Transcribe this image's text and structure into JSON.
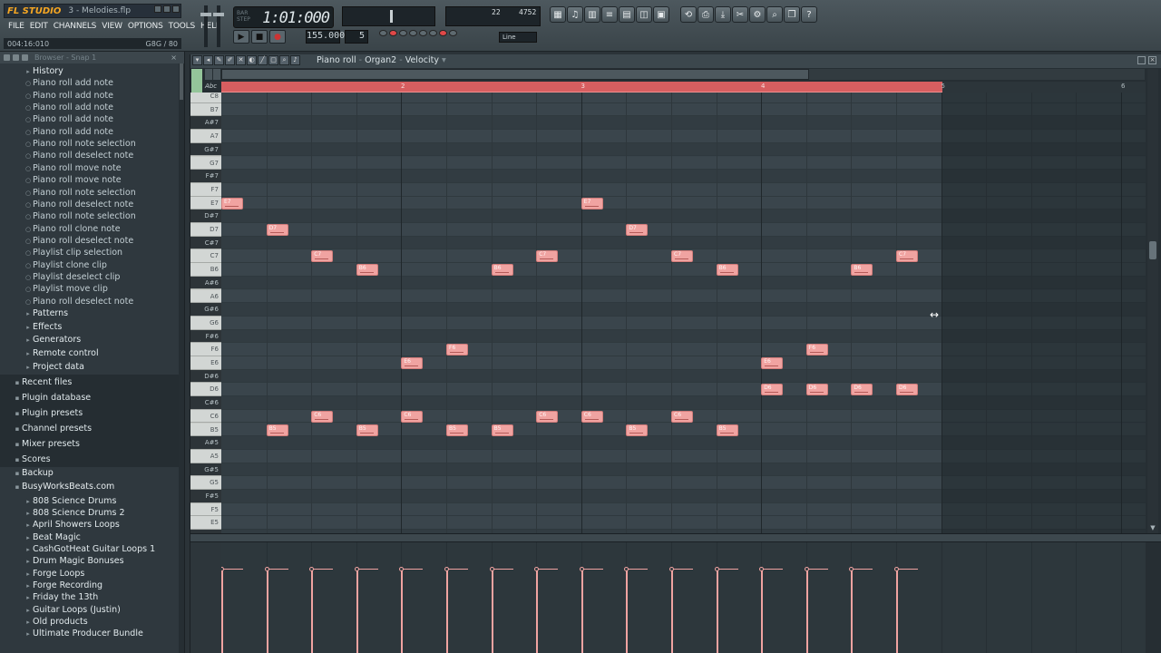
{
  "app": {
    "logo": "FL STUDIO",
    "project": "3 - Melodies.flp",
    "menu": [
      "FILE",
      "EDIT",
      "CHANNELS",
      "VIEW",
      "OPTIONS",
      "TOOLS",
      "HELP"
    ],
    "hint_left": "004:16:010",
    "hint_right": "G8G / 80"
  },
  "transport": {
    "time_pre": "BAR\nSTEP",
    "time": "1:01:000",
    "tempo": "155.000",
    "pattern": "5",
    "cpu_left": "22",
    "cpu_right": "4752",
    "snap": "Line"
  },
  "toolbar_icons": [
    "playlist-icon",
    "piano-roll-icon",
    "step-seq-icon",
    "mixer-icon",
    "channel-icon",
    "plugin-icon",
    "view-icon",
    "undo-icon",
    "save-icon",
    "export-icon",
    "render-icon",
    "tools-icon",
    "search-icon",
    "files-icon",
    "help-icon"
  ],
  "browser": {
    "title": "Browser - Snap 1",
    "close": "×",
    "items": [
      {
        "label": "History",
        "kind": "folder"
      },
      {
        "label": "Piano roll add note",
        "kind": "item"
      },
      {
        "label": "Piano roll add note",
        "kind": "item"
      },
      {
        "label": "Piano roll add note",
        "kind": "item"
      },
      {
        "label": "Piano roll add note",
        "kind": "item"
      },
      {
        "label": "Piano roll add note",
        "kind": "item"
      },
      {
        "label": "Piano roll note selection",
        "kind": "item"
      },
      {
        "label": "Piano roll deselect note",
        "kind": "item"
      },
      {
        "label": "Piano roll move note",
        "kind": "item"
      },
      {
        "label": "Piano roll move note",
        "kind": "item"
      },
      {
        "label": "Piano roll note selection",
        "kind": "item"
      },
      {
        "label": "Piano roll deselect note",
        "kind": "item"
      },
      {
        "label": "Piano roll note selection",
        "kind": "item"
      },
      {
        "label": "Piano roll clone note",
        "kind": "item"
      },
      {
        "label": "Piano roll deselect note",
        "kind": "item"
      },
      {
        "label": "Playlist clip selection",
        "kind": "item"
      },
      {
        "label": "Playlist clone clip",
        "kind": "item"
      },
      {
        "label": "Playlist deselect clip",
        "kind": "item"
      },
      {
        "label": "Playlist move clip",
        "kind": "item"
      },
      {
        "label": "Piano roll deselect note",
        "kind": "item"
      },
      {
        "label": "Patterns",
        "kind": "folder"
      },
      {
        "label": "Effects",
        "kind": "folder"
      },
      {
        "label": "Generators",
        "kind": "folder"
      },
      {
        "label": "Remote control",
        "kind": "folder"
      },
      {
        "label": "Project data",
        "kind": "folder"
      },
      {
        "label": "Recent files",
        "kind": "section"
      },
      {
        "label": "Plugin database",
        "kind": "section"
      },
      {
        "label": "Plugin presets",
        "kind": "section"
      },
      {
        "label": "Channel presets",
        "kind": "section"
      },
      {
        "label": "Mixer presets",
        "kind": "section"
      },
      {
        "label": "Scores",
        "kind": "section"
      },
      {
        "label": "Backup",
        "kind": "section-hdr"
      },
      {
        "label": "BusyWorksBeats.com",
        "kind": "section-hdr"
      },
      {
        "label": "808 Science Drums",
        "kind": "folder"
      },
      {
        "label": "808 Science Drums 2",
        "kind": "folder"
      },
      {
        "label": "April Showers Loops",
        "kind": "folder"
      },
      {
        "label": "Beat Magic",
        "kind": "folder"
      },
      {
        "label": "CashGotHeat Guitar Loops 1",
        "kind": "folder"
      },
      {
        "label": "Drum Magic Bonuses",
        "kind": "folder"
      },
      {
        "label": "Forge Loops",
        "kind": "folder"
      },
      {
        "label": "Forge Recording",
        "kind": "folder"
      },
      {
        "label": "Friday the 13th",
        "kind": "folder"
      },
      {
        "label": "Guitar Loops (Justin)",
        "kind": "folder"
      },
      {
        "label": "Old products",
        "kind": "folder"
      },
      {
        "label": "Ultimate Producer Bundle",
        "kind": "folder"
      }
    ]
  },
  "piano_roll": {
    "title_parts": [
      "Piano roll",
      "Organ2",
      "Velocity"
    ],
    "abc": "Abc",
    "bars": [
      "2",
      "3",
      "4",
      "5",
      "6"
    ],
    "keys": [
      "C8",
      "B7",
      "A#7",
      "A7",
      "G#7",
      "G7",
      "F#7",
      "F7",
      "E7",
      "D#7",
      "D7",
      "C#7",
      "C7",
      "B6",
      "A#6",
      "A6",
      "G#6",
      "G6",
      "F#6",
      "F6",
      "E6",
      "D#6",
      "D6",
      "C#6",
      "C6",
      "B5",
      "A#5",
      "A5",
      "G#5",
      "G5",
      "F#5",
      "F5",
      "E5",
      "D#5"
    ],
    "notes": [
      {
        "key": "E7",
        "step": 0,
        "label": "E7"
      },
      {
        "key": "D7",
        "step": 1,
        "label": "D7"
      },
      {
        "key": "C7",
        "step": 2,
        "label": "C7"
      },
      {
        "key": "B6",
        "step": 3,
        "label": "B6"
      },
      {
        "key": "E6",
        "step": 4,
        "label": "E6"
      },
      {
        "key": "F6",
        "step": 5,
        "label": "F6"
      },
      {
        "key": "B6",
        "step": 6,
        "label": "B6"
      },
      {
        "key": "C7",
        "step": 7,
        "label": "C7"
      },
      {
        "key": "E7",
        "step": 8,
        "label": "E7"
      },
      {
        "key": "D7",
        "step": 9,
        "label": "D7"
      },
      {
        "key": "C7",
        "step": 10,
        "label": "C7"
      },
      {
        "key": "B6",
        "step": 11,
        "label": "B6"
      },
      {
        "key": "E6",
        "step": 12,
        "label": "E6"
      },
      {
        "key": "F6",
        "step": 13,
        "label": "F6"
      },
      {
        "key": "B6",
        "step": 14,
        "label": "B6"
      },
      {
        "key": "C7",
        "step": 15,
        "label": "C7"
      },
      {
        "key": "B5",
        "step": 1,
        "label": "B5"
      },
      {
        "key": "C6",
        "step": 2,
        "label": "C6"
      },
      {
        "key": "B5",
        "step": 3,
        "label": "B5"
      },
      {
        "key": "C6",
        "step": 4,
        "label": "C6"
      },
      {
        "key": "B5",
        "step": 5,
        "label": "B5"
      },
      {
        "key": "B5",
        "step": 6,
        "label": "B5"
      },
      {
        "key": "C6",
        "step": 7,
        "label": "C6"
      },
      {
        "key": "C6",
        "step": 8,
        "label": "C6"
      },
      {
        "key": "B5",
        "step": 9,
        "label": "B5"
      },
      {
        "key": "C6",
        "step": 10,
        "label": "C6"
      },
      {
        "key": "B5",
        "step": 11,
        "label": "B5"
      },
      {
        "key": "D6",
        "step": 12,
        "label": "D6"
      },
      {
        "key": "D6",
        "step": 13,
        "label": "D6"
      },
      {
        "key": "D6",
        "step": 14,
        "label": "D6"
      },
      {
        "key": "D6",
        "step": 15,
        "label": "D6"
      }
    ],
    "velocities": [
      0.8,
      0.8,
      0.8,
      0.8,
      0.8,
      0.8,
      0.8,
      0.8,
      0.8,
      0.8,
      0.8,
      0.8,
      0.8,
      0.8,
      0.8,
      0.8
    ],
    "note_color": "#f0a3a1",
    "loop_color": "#d75e60"
  }
}
